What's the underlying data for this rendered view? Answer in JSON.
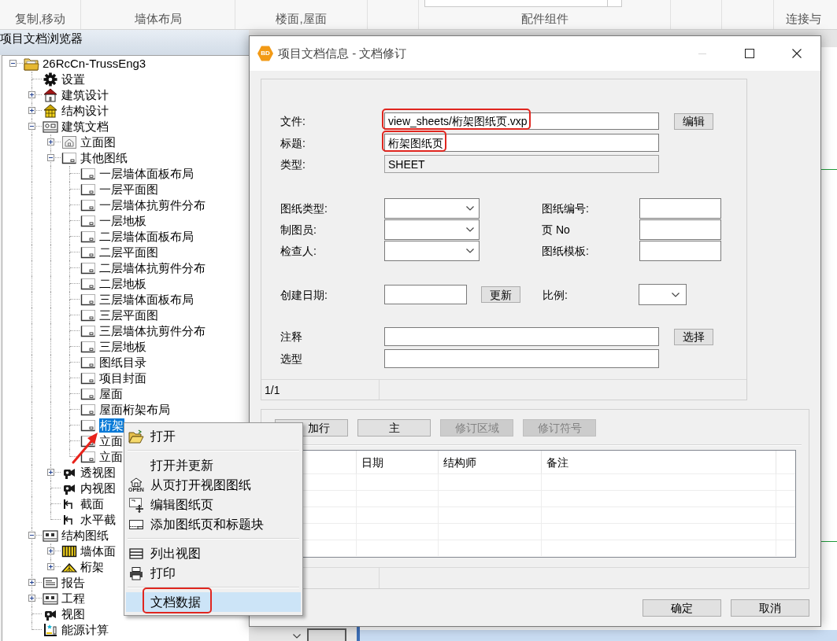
{
  "ribbon": {
    "groups": [
      "复制,移动",
      "墙体布局",
      "楼面,屋面",
      "配件组件",
      "连接与"
    ]
  },
  "tree": {
    "title": "项目文档浏览器",
    "annotation_arrow": true,
    "nodes": [
      {
        "label": "26RcCn-TrussEng3",
        "kind": "project",
        "expanded": true,
        "selected": false,
        "children": [
          {
            "label": "设置",
            "kind": "settings",
            "selected": false
          },
          {
            "label": "建筑设计",
            "kind": "architecture",
            "expanded": false,
            "selected": false
          },
          {
            "label": "结构设计",
            "kind": "structure",
            "expanded": false,
            "selected": false
          },
          {
            "label": "建筑文档",
            "kind": "documents",
            "expanded": true,
            "selected": false,
            "children": [
              {
                "label": "立面图",
                "kind": "elevation",
                "expanded": false,
                "selected": false
              },
              {
                "label": "其他图纸",
                "kind": "sheet",
                "expanded": true,
                "selected": false,
                "children": [
                  {
                    "label": "一层墙体面板布局",
                    "kind": "sheet",
                    "selected": false
                  },
                  {
                    "label": "一层平面图",
                    "kind": "sheet",
                    "selected": false
                  },
                  {
                    "label": "一层墙体抗剪件分布",
                    "kind": "sheet",
                    "selected": false
                  },
                  {
                    "label": "一层地板",
                    "kind": "sheet",
                    "selected": false
                  },
                  {
                    "label": "二层墙体面板布局",
                    "kind": "sheet",
                    "selected": false
                  },
                  {
                    "label": "二层平面图",
                    "kind": "sheet",
                    "selected": false
                  },
                  {
                    "label": "二层墙体抗剪件分布",
                    "kind": "sheet",
                    "selected": false
                  },
                  {
                    "label": "二层地板",
                    "kind": "sheet",
                    "selected": false
                  },
                  {
                    "label": "三层墙体面板布局",
                    "kind": "sheet",
                    "selected": false
                  },
                  {
                    "label": "三层平面图",
                    "kind": "sheet",
                    "selected": false
                  },
                  {
                    "label": "三层墙体抗剪件分布",
                    "kind": "sheet",
                    "selected": false
                  },
                  {
                    "label": "三层地板",
                    "kind": "sheet",
                    "selected": false
                  },
                  {
                    "label": "图纸目录",
                    "kind": "sheet",
                    "selected": false
                  },
                  {
                    "label": "项目封面",
                    "kind": "sheet",
                    "selected": false
                  },
                  {
                    "label": "屋面",
                    "kind": "sheet",
                    "selected": false
                  },
                  {
                    "label": "屋面桁架布局",
                    "kind": "sheet",
                    "selected": false
                  },
                  {
                    "label": "桁架",
                    "kind": "sheet",
                    "selected": true
                  },
                  {
                    "label": "立面",
                    "kind": "sheet",
                    "selected": false
                  },
                  {
                    "label": "立面",
                    "kind": "sheet",
                    "selected": false
                  }
                ]
              },
              {
                "label": "透视图",
                "kind": "camera",
                "expanded": false,
                "selected": false
              },
              {
                "label": "内视图",
                "kind": "camera",
                "selected": false
              },
              {
                "label": "截面",
                "kind": "section",
                "selected": false
              },
              {
                "label": "水平截",
                "kind": "section",
                "selected": false
              }
            ]
          },
          {
            "label": "结构图纸",
            "kind": "drawings",
            "expanded": true,
            "selected": false,
            "children": [
              {
                "label": "墙体面",
                "kind": "wall-panels",
                "expanded": false,
                "selected": false
              },
              {
                "label": "桁架",
                "kind": "truss",
                "expanded": false,
                "selected": false
              }
            ]
          },
          {
            "label": "报告",
            "kind": "report",
            "expanded": false,
            "selected": false
          },
          {
            "label": "工程",
            "kind": "drawings",
            "expanded": false,
            "selected": false
          },
          {
            "label": "视图",
            "kind": "camera",
            "selected": false
          },
          {
            "label": "能源计算",
            "kind": "energy",
            "selected": false
          }
        ]
      }
    ]
  },
  "dialog": {
    "badge": "BD",
    "title": "项目文档信息 - 文档修订",
    "minimize": {
      "disabled": true
    },
    "file_fields": [
      {
        "label": "文件:",
        "value": "view_sheets/桁架图纸页.vxp",
        "button": "编辑",
        "kind": "text",
        "annotated": true
      },
      {
        "label": "标题:",
        "value": "桁架图纸页",
        "kind": "text",
        "annotated": true
      },
      {
        "label": "类型:",
        "value": "SHEET",
        "kind": "readonly",
        "annotated": false
      }
    ],
    "sheet_fields": {
      "left": [
        {
          "label": "图纸类型:"
        },
        {
          "label": "制图员:"
        },
        {
          "label": "检查人:"
        }
      ],
      "right": [
        {
          "label": "图纸编号:"
        },
        {
          "label": "页 No"
        },
        {
          "label": "图纸模板:"
        }
      ]
    },
    "date_field": {
      "label": "创建日期:",
      "button": "更新"
    },
    "scale_field": {
      "label": "比例:"
    },
    "note_fields": [
      {
        "label": "注释",
        "button": "选择"
      },
      {
        "label": "选型"
      }
    ],
    "status": "1/1",
    "revisions": {
      "buttons": [
        {
          "label": "加行",
          "disabled": false
        },
        {
          "label": "主",
          "disabled": false
        },
        {
          "label": "修订区域",
          "disabled": true
        },
        {
          "label": "修订符号",
          "disabled": true
        }
      ],
      "columns": [
        "日期",
        "结构师",
        "备注"
      ]
    },
    "footer_buttons": [
      "确定",
      "取消"
    ]
  },
  "context_menu": {
    "groups": [
      {
        "items": [
          {
            "label": "打开",
            "kind": "open",
            "selected": false,
            "annotated": false
          }
        ]
      },
      {
        "items": [
          {
            "label": "打开并更新",
            "kind": "plain",
            "selected": false,
            "annotated": false
          },
          {
            "label": "从页打开视图图纸",
            "kind": "open-page",
            "icon_caption": "OPEN",
            "selected": false,
            "annotated": false
          },
          {
            "label": "编辑图纸页",
            "kind": "edit-sheet",
            "selected": false,
            "annotated": false
          },
          {
            "label": "添加图纸页和标题块",
            "kind": "add-sheet",
            "selected": false,
            "annotated": false
          }
        ]
      },
      {
        "items": [
          {
            "label": "列出视图",
            "kind": "list",
            "selected": false,
            "annotated": false
          },
          {
            "label": "打印",
            "kind": "print",
            "selected": false,
            "annotated": false
          }
        ]
      },
      {
        "items": [
          {
            "label": "文档数据",
            "kind": "plain",
            "selected": true,
            "annotated": true
          }
        ]
      }
    ]
  }
}
